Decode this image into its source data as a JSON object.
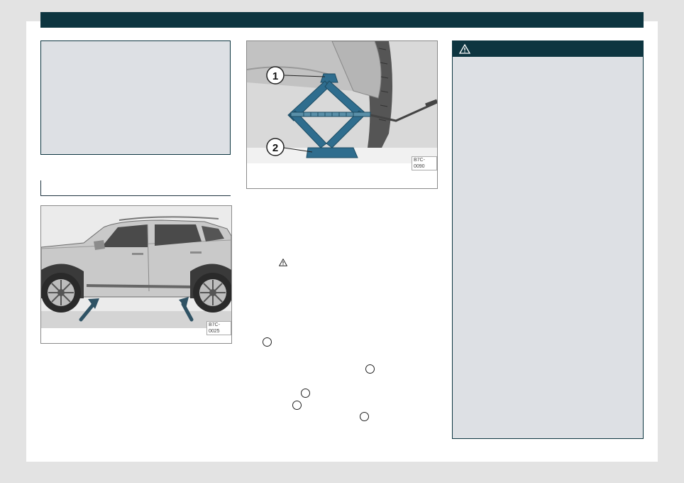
{
  "figures": {
    "car_side": {
      "code": "B7C-0025"
    },
    "jack": {
      "code": "B7C-0090",
      "callout_1": "1",
      "callout_2": "2"
    }
  },
  "icons": {
    "warning": "warning-triangle-icon",
    "reference": "circled-reference-icon"
  },
  "colors": {
    "header": "#0d3540",
    "panel": "#dde0e4",
    "jack": "#2f6d8e"
  }
}
